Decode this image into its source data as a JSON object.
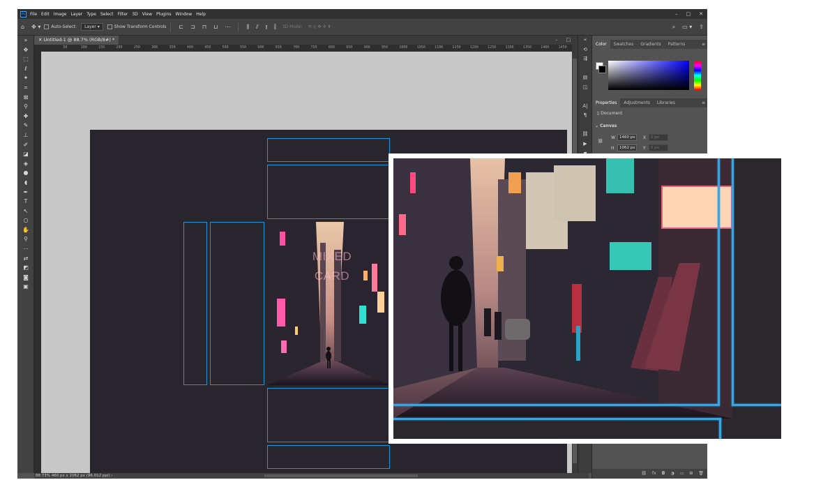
{
  "app": {
    "logo": "Ps"
  },
  "menu": [
    "File",
    "Edit",
    "Image",
    "Layer",
    "Type",
    "Select",
    "Filter",
    "3D",
    "View",
    "Plugins",
    "Window",
    "Help"
  ],
  "window_controls": {
    "minimize": "–",
    "maximize": "□",
    "close": "✕"
  },
  "options": {
    "home_icon": "home-icon",
    "move_icon": "move-tool-icon",
    "auto_select_label": "Auto-Select:",
    "auto_select_value": "Layer",
    "show_transform_label": "Show Transform Controls",
    "mode_label": "3D Mode:"
  },
  "document": {
    "tab_title": "Untitled-1 @ 88.7% (RGB/8#) *",
    "card_text_line1": "MIXED",
    "card_text_line2": "CARD"
  },
  "ruler_ticks": [
    "50",
    "100",
    "150",
    "200",
    "250",
    "300",
    "350",
    "400",
    "450",
    "500",
    "550",
    "600",
    "650",
    "700",
    "750",
    "800",
    "850",
    "900",
    "950",
    "1000",
    "1050",
    "1100",
    "1150",
    "1200",
    "1250",
    "1300",
    "1350",
    "1400",
    "1450"
  ],
  "status": {
    "text": "88.73%  460 px x 1062 px (96.012 ppi)  ›"
  },
  "panels": {
    "color_tabs": [
      "Color",
      "Swatches",
      "Gradients",
      "Patterns"
    ],
    "props_tabs": [
      "Properties",
      "Adjustments",
      "Libraries"
    ],
    "doc_label": "Document",
    "canvas_section": "Canvas",
    "w_label": "W",
    "w_value": "1460 px",
    "h_label": "H",
    "h_value": "1062 px",
    "x_label": "X",
    "x_value": "0 px",
    "y_label": "Y",
    "y_value": "0 px"
  },
  "colors": {
    "guide": "#1e95d6",
    "canvas_bg": "#28262c",
    "accent": "#31a8ff"
  }
}
